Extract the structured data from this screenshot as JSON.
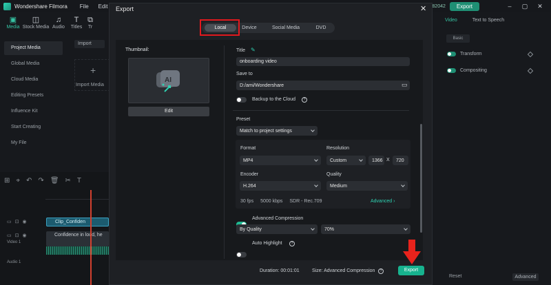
{
  "app": {
    "name": "Wondershare Filmora",
    "menus": [
      "File",
      "Edit"
    ],
    "credits": "82042",
    "export_label": "Export"
  },
  "left_panel": {
    "tabs": [
      "Media",
      "Stock Media",
      "Audio",
      "Titles",
      "Tr"
    ],
    "sidebar": [
      "Project Media",
      "Global Media",
      "Cloud Media",
      "Editing Presets",
      "Influence Kit",
      "Start Creating",
      "My File"
    ],
    "import_select": "Import",
    "import_label": "Import Media"
  },
  "timeline": {
    "clip_title": "Clip_Confiden",
    "video_clip": "Confidence in loud, he",
    "video_track_label": "Video 1",
    "audio_track_label": "Audio 1"
  },
  "right_panel": {
    "tabs": [
      "Video",
      "Text to Speech"
    ],
    "basic_label": "Basic",
    "rows": [
      "Transform",
      "Compositing"
    ],
    "reset_label": "Reset",
    "advanced_label": "Advanced"
  },
  "export_dialog": {
    "title": "Export",
    "tabs": [
      "Local",
      "Device",
      "Social Media",
      "DVD"
    ],
    "thumbnail_label": "Thumbnail:",
    "edit_label": "Edit",
    "title_label": "Title",
    "title_value": "onboarding video",
    "save_to_label": "Save to",
    "save_to_value": "D:/ami/Wondershare",
    "backup_label": "Backup to the Cloud",
    "preset_label": "Preset",
    "preset_value": "Match to project settings",
    "format_label": "Format",
    "format_value": "MP4",
    "resolution_label": "Resolution",
    "resolution_value": "Custom",
    "res_width": "1366",
    "res_x": "X",
    "res_height": "720",
    "encoder_label": "Encoder",
    "encoder_value": "H.264",
    "quality_label": "Quality",
    "quality_value": "Medium",
    "specs": [
      "30 fps",
      "5000 kbps",
      "SDR - Rec.709"
    ],
    "advanced_link": "Advanced",
    "adv_compression_label": "Advanced Compression",
    "by_quality_value": "By Quality",
    "percent_value": "70%",
    "auto_highlight_label": "Auto Highlight",
    "duration_label": "Duration:",
    "duration_value": "00:01:01",
    "size_label": "Size:",
    "size_value": "Advanced Compression",
    "export_button": "Export"
  },
  "colors": {
    "accent": "#17b38f",
    "highlight_box": "#e2191e",
    "arrow": "#e8231c"
  }
}
